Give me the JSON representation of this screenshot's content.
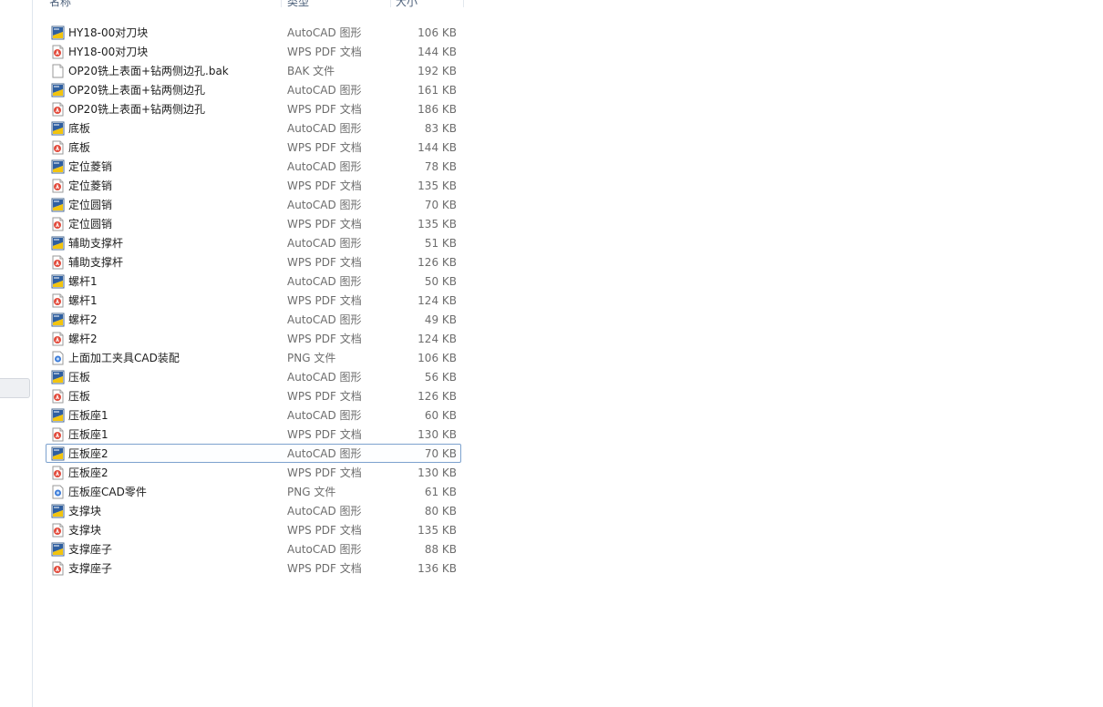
{
  "header": {
    "name": "名称",
    "type": "类型",
    "size": "大小"
  },
  "colors": {
    "selection_border": "#7da2ce",
    "header_text": "#4c607a"
  },
  "files": [
    {
      "name": "HY18-00对刀块",
      "type": "AutoCAD 图形",
      "size": "106 KB",
      "icon": "autocad-drawing-icon"
    },
    {
      "name": "HY18-00对刀块",
      "type": "WPS PDF 文档",
      "size": "144 KB",
      "icon": "pdf-icon"
    },
    {
      "name": "OP20铣上表面+钻两侧边孔.bak",
      "type": "BAK 文件",
      "size": "192 KB",
      "icon": "generic-file-icon"
    },
    {
      "name": "OP20铣上表面+钻两侧边孔",
      "type": "AutoCAD 图形",
      "size": "161 KB",
      "icon": "autocad-drawing-icon"
    },
    {
      "name": "OP20铣上表面+钻两侧边孔",
      "type": "WPS PDF 文档",
      "size": "186 KB",
      "icon": "pdf-icon"
    },
    {
      "name": "底板",
      "type": "AutoCAD 图形",
      "size": "83 KB",
      "icon": "autocad-drawing-icon"
    },
    {
      "name": "底板",
      "type": "WPS PDF 文档",
      "size": "144 KB",
      "icon": "pdf-icon"
    },
    {
      "name": "定位菱销",
      "type": "AutoCAD 图形",
      "size": "78 KB",
      "icon": "autocad-drawing-icon"
    },
    {
      "name": "定位菱销",
      "type": "WPS PDF 文档",
      "size": "135 KB",
      "icon": "pdf-icon"
    },
    {
      "name": "定位圆销",
      "type": "AutoCAD 图形",
      "size": "70 KB",
      "icon": "autocad-drawing-icon"
    },
    {
      "name": "定位圆销",
      "type": "WPS PDF 文档",
      "size": "135 KB",
      "icon": "pdf-icon"
    },
    {
      "name": "辅助支撑杆",
      "type": "AutoCAD 图形",
      "size": "51 KB",
      "icon": "autocad-drawing-icon"
    },
    {
      "name": "辅助支撑杆",
      "type": "WPS PDF 文档",
      "size": "126 KB",
      "icon": "pdf-icon"
    },
    {
      "name": "螺杆1",
      "type": "AutoCAD 图形",
      "size": "50 KB",
      "icon": "autocad-drawing-icon"
    },
    {
      "name": "螺杆1",
      "type": "WPS PDF 文档",
      "size": "124 KB",
      "icon": "pdf-icon"
    },
    {
      "name": "螺杆2",
      "type": "AutoCAD 图形",
      "size": "49 KB",
      "icon": "autocad-drawing-icon"
    },
    {
      "name": "螺杆2",
      "type": "WPS PDF 文档",
      "size": "124 KB",
      "icon": "pdf-icon"
    },
    {
      "name": "上面加工夹具CAD装配",
      "type": "PNG 文件",
      "size": "106 KB",
      "icon": "png-image-icon"
    },
    {
      "name": "压板",
      "type": "AutoCAD 图形",
      "size": "56 KB",
      "icon": "autocad-drawing-icon"
    },
    {
      "name": "压板",
      "type": "WPS PDF 文档",
      "size": "126 KB",
      "icon": "pdf-icon"
    },
    {
      "name": "压板座1",
      "type": "AutoCAD 图形",
      "size": "60 KB",
      "icon": "autocad-drawing-icon"
    },
    {
      "name": "压板座1",
      "type": "WPS PDF 文档",
      "size": "130 KB",
      "icon": "pdf-icon"
    },
    {
      "name": "压板座2",
      "type": "AutoCAD 图形",
      "size": "70 KB",
      "icon": "autocad-drawing-icon",
      "selected": true
    },
    {
      "name": "压板座2",
      "type": "WPS PDF 文档",
      "size": "130 KB",
      "icon": "pdf-icon"
    },
    {
      "name": "压板座CAD零件",
      "type": "PNG 文件",
      "size": "61 KB",
      "icon": "png-image-icon"
    },
    {
      "name": "支撑块",
      "type": "AutoCAD 图形",
      "size": "80 KB",
      "icon": "autocad-drawing-icon"
    },
    {
      "name": "支撑块",
      "type": "WPS PDF 文档",
      "size": "135 KB",
      "icon": "pdf-icon"
    },
    {
      "name": "支撑座子",
      "type": "AutoCAD 图形",
      "size": "88 KB",
      "icon": "autocad-drawing-icon"
    },
    {
      "name": "支撑座子",
      "type": "WPS PDF 文档",
      "size": "136 KB",
      "icon": "pdf-icon"
    }
  ]
}
